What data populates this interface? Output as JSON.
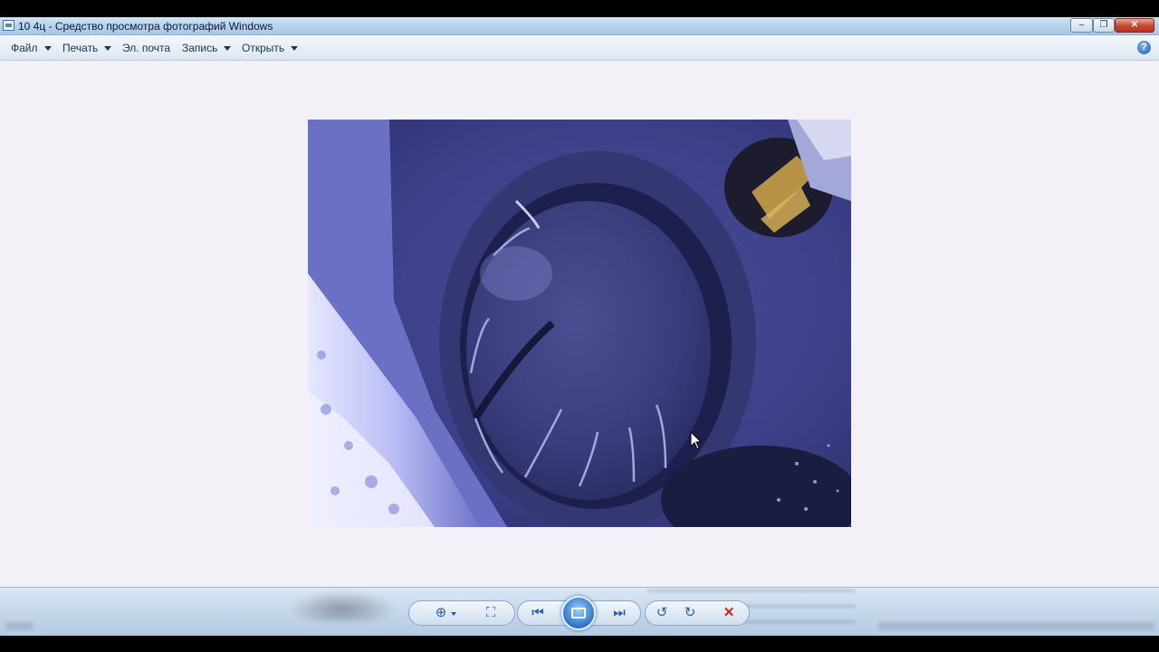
{
  "window": {
    "title": "10 4ц - Средство просмотра фотографий Windows",
    "controls": {
      "minimize": "–",
      "maximize": "❐",
      "close": "✕"
    }
  },
  "menubar": {
    "items": [
      {
        "label": "Файл"
      },
      {
        "label": "Печать"
      },
      {
        "label": "Эл. почта"
      },
      {
        "label": "Запись"
      },
      {
        "label": "Открыть"
      }
    ],
    "help": "?"
  },
  "toolbar": {
    "zoom_icon": "⊕",
    "fit_icon": "⛶",
    "prev_icon": "⏮",
    "next_icon": "⏭",
    "rotate_left_icon": "↺",
    "rotate_right_icon": "↻",
    "delete_icon": "✕"
  },
  "colors": {
    "photo_tint": "#5a5fb8",
    "accent": "#2a5f9e",
    "delete": "#d1231d"
  }
}
